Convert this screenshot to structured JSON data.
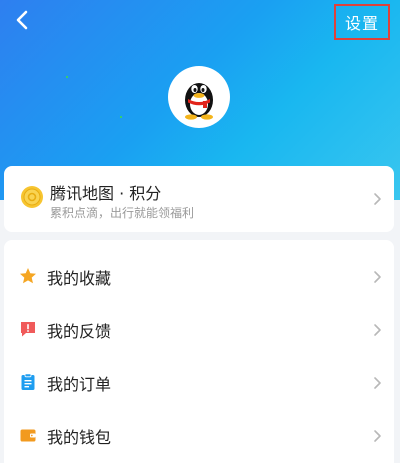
{
  "header": {
    "back_icon": "chevron-left-icon",
    "settings_label": "设置",
    "colors": {
      "gradient_start": "#2e7ff0",
      "gradient_end": "#39c6ef",
      "highlight_border": "#e0413a"
    }
  },
  "profile": {
    "avatar_icon": "qq-penguin-icon"
  },
  "points_card": {
    "icon": "points-coin-icon",
    "title": "腾讯地图 · 积分",
    "subtitle": "累积点滴，出行就能领福利",
    "chevron_icon": "chevron-right-icon"
  },
  "menu": {
    "items": [
      {
        "label": "我的收藏",
        "icon": "star-icon",
        "color": "#f5a623"
      },
      {
        "label": "我的反馈",
        "icon": "feedback-icon",
        "color": "#f05a5a"
      },
      {
        "label": "我的订单",
        "icon": "order-clipboard-icon",
        "color": "#1e9df0"
      },
      {
        "label": "我的钱包",
        "icon": "wallet-icon",
        "color": "#f29a1f"
      }
    ]
  }
}
